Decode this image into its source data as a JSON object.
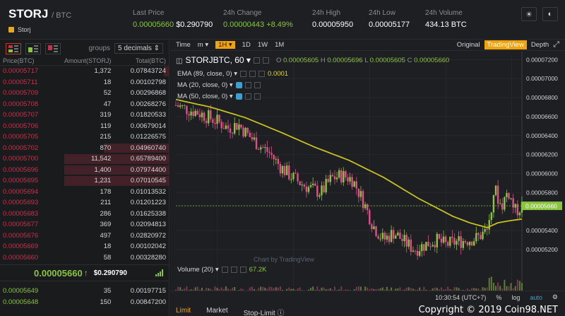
{
  "header": {
    "pair": "STORJ",
    "quote": "/ BTC",
    "coin_name": "Storj",
    "last_price_label": "Last Price",
    "last_price_btc": "0.00005660",
    "last_price_usd": "$0.290790",
    "change_label": "24h Change",
    "change_value": "0.00000443",
    "change_pct": "+8.49%",
    "high_label": "24h High",
    "high_value": "0.00005950",
    "low_label": "24h Low",
    "low_value": "0.00005177",
    "volume_label": "24h Volume",
    "volume_value": "434.13 BTC",
    "theme_icon": "☀",
    "contrast_icon": "◐"
  },
  "orderbook": {
    "groups_label": "groups",
    "groups_value": "5 decimals ⇕",
    "col_price": "Price(BTC)",
    "col_amount": "Amount(STORJ)",
    "col_total": "Total(BTC)",
    "asks": [
      {
        "price": "0.00005717",
        "amount": "1,372",
        "total": "0.07843724",
        "depth": 0.05
      },
      {
        "price": "0.00005711",
        "amount": "18",
        "total": "0.00102798",
        "depth": 0.0
      },
      {
        "price": "0.00005709",
        "amount": "52",
        "total": "0.00296868",
        "depth": 0.0
      },
      {
        "price": "0.00005708",
        "amount": "47",
        "total": "0.00268276",
        "depth": 0.0
      },
      {
        "price": "0.00005707",
        "amount": "319",
        "total": "0.01820533",
        "depth": 0.0
      },
      {
        "price": "0.00005706",
        "amount": "119",
        "total": "0.00679014",
        "depth": 0.0
      },
      {
        "price": "0.00005705",
        "amount": "215",
        "total": "0.01226575",
        "depth": 0.0
      },
      {
        "price": "0.00005702",
        "amount": "870",
        "total": "0.04960740",
        "depth": 0.62
      },
      {
        "price": "0.00005700",
        "amount": "11,542",
        "total": "0.65789400",
        "depth": 1.0
      },
      {
        "price": "0.00005696",
        "amount": "1,400",
        "total": "0.07974400",
        "depth": 1.0
      },
      {
        "price": "0.00005695",
        "amount": "1,231",
        "total": "0.07010545",
        "depth": 1.0
      },
      {
        "price": "0.00005694",
        "amount": "178",
        "total": "0.01013532",
        "depth": 0.0
      },
      {
        "price": "0.00005693",
        "amount": "211",
        "total": "0.01201223",
        "depth": 0.0
      },
      {
        "price": "0.00005683",
        "amount": "286",
        "total": "0.01625338",
        "depth": 0.0
      },
      {
        "price": "0.00005677",
        "amount": "369",
        "total": "0.02094813",
        "depth": 0.0
      },
      {
        "price": "0.00005676",
        "amount": "497",
        "total": "0.02820972",
        "depth": 0.0
      },
      {
        "price": "0.00005669",
        "amount": "18",
        "total": "0.00102042",
        "depth": 0.0
      },
      {
        "price": "0.00005660",
        "amount": "58",
        "total": "0.00328280",
        "depth": 0.0
      }
    ],
    "last_price": "0.00005660",
    "last_arrow": "↑",
    "last_usd": "$0.290790",
    "bids": [
      {
        "price": "0.00005649",
        "amount": "35",
        "total": "0.00197715"
      },
      {
        "price": "0.00005648",
        "amount": "150",
        "total": "0.00847200"
      }
    ]
  },
  "chart_toolbar": {
    "time": "Time",
    "m": "m ▾",
    "interval": "1H ▾",
    "d": "1D",
    "w": "1W",
    "mo": "1M",
    "original": "Original",
    "tradingview": "TradingView",
    "depth": "Depth",
    "fullscreen_icon": "⤢"
  },
  "chart_legend": {
    "symbol": "STORJBTC, 60 ▾",
    "o_label": "O",
    "o": "0.00005605",
    "h_label": "H",
    "h": "0.00005696",
    "l_label": "L",
    "l": "0.00005605",
    "c_label": "C",
    "c": "0.00005660",
    "ema": "EMA (89, close, 0) ▾",
    "ema_val": "0.0001",
    "ma20": "MA (20, close, 0) ▾",
    "ma50": "MA (50, close, 0) ▾",
    "volume": "Volume (20) ▾",
    "volume_val": "67.2K",
    "watermark": "Chart by TradingView"
  },
  "chart_bottom": {
    "time": "10:30:54 (UTC+7)",
    "pct": "%",
    "log": "log",
    "auto": "auto",
    "gear_icon": "⚙"
  },
  "order_tabs": [
    "Limit",
    "Market",
    "Stop-Limit ⓘ"
  ],
  "copyright": "Copyright © 2019 Coin98.NET",
  "chart_data": {
    "type": "line",
    "title": "STORJBTC, 60",
    "ylim": [
      5.05e-05,
      7.24e-05
    ],
    "y_ticks": [
      "0.00007200",
      "0.00007000",
      "0.00006800",
      "0.00006600",
      "0.00006400",
      "0.00006200",
      "0.00006000",
      "0.00005800",
      "0.00005660",
      "0.00005400",
      "0.00005200"
    ],
    "y_tick_values": [
      7.2e-05,
      7e-05,
      6.8e-05,
      6.6e-05,
      6.4e-05,
      6.2e-05,
      6e-05,
      5.8e-05,
      5.66e-05,
      5.4e-05,
      5.2e-05
    ],
    "x_ticks": [
      "7",
      "9",
      "11",
      "13",
      "15"
    ],
    "x_tick_positions": [
      0.12,
      0.34,
      0.56,
      0.78,
      0.97
    ],
    "series": [
      {
        "name": "Price",
        "color": "#8bc53f",
        "x": [
          0,
          0.03,
          0.06,
          0.09,
          0.12,
          0.15,
          0.18,
          0.21,
          0.24,
          0.27,
          0.3,
          0.33,
          0.36,
          0.39,
          0.42,
          0.45,
          0.48,
          0.51,
          0.54,
          0.57,
          0.6,
          0.63,
          0.66,
          0.69,
          0.72,
          0.75,
          0.78,
          0.81,
          0.84,
          0.87,
          0.9,
          0.92,
          0.94,
          0.96,
          0.98,
          1.0
        ],
        "values": [
          6.72e-05,
          6.68e-05,
          6.65e-05,
          6.6e-05,
          6.55e-05,
          6.48e-05,
          6.52e-05,
          6.4e-05,
          6.3e-05,
          6.22e-05,
          6.08e-05,
          5.98e-05,
          5.9e-05,
          5.84e-05,
          5.8e-05,
          5.95e-05,
          5.98e-05,
          5.94e-05,
          5.72e-05,
          5.45e-05,
          5.3e-05,
          5.38e-05,
          5.28e-05,
          5.2e-05,
          5.25e-05,
          5.3e-05,
          5.25e-05,
          5.28e-05,
          5.3e-05,
          5.32e-05,
          5.4e-05,
          5.85e-05,
          5.65e-05,
          5.82e-05,
          5.6e-05,
          5.66e-05
        ]
      },
      {
        "name": "EMA",
        "color": "#c8c021",
        "x": [
          0,
          0.1,
          0.2,
          0.3,
          0.4,
          0.5,
          0.6,
          0.7,
          0.8,
          0.85,
          0.9,
          0.93,
          0.96,
          1.0
        ],
        "values": [
          6.78e-05,
          6.7e-05,
          6.59e-05,
          6.44e-05,
          6.28e-05,
          6.14e-05,
          5.96e-05,
          5.74e-05,
          5.55e-05,
          5.48e-05,
          5.43e-05,
          5.48e-05,
          5.5e-05,
          5.52e-05
        ]
      }
    ]
  }
}
